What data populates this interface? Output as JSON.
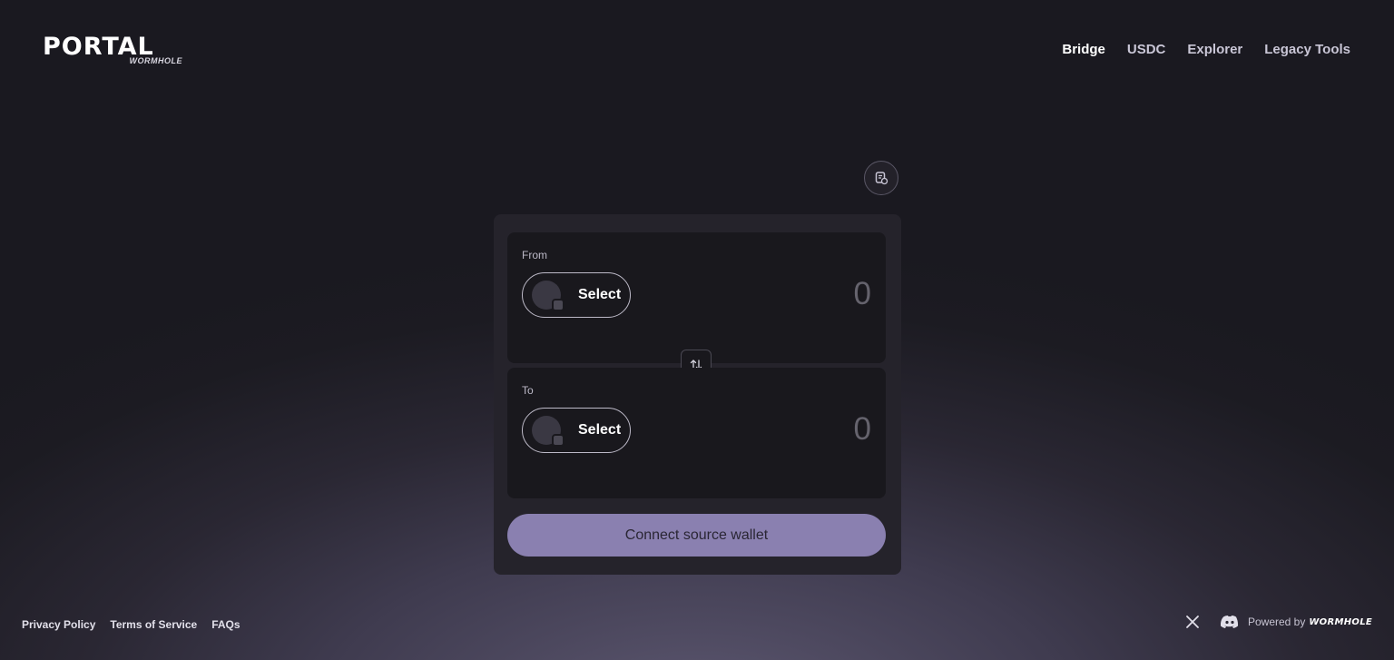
{
  "brand": {
    "name": "PORTAL",
    "sub": "WORMHOLE"
  },
  "nav": [
    {
      "label": "Bridge",
      "active": true
    },
    {
      "label": "USDC",
      "active": false
    },
    {
      "label": "Explorer",
      "active": false
    },
    {
      "label": "Legacy Tools",
      "active": false
    }
  ],
  "settings": {
    "icon": "transaction-history-icon"
  },
  "bridge": {
    "from": {
      "label": "From",
      "select": "Select",
      "amount": "0"
    },
    "to": {
      "label": "To",
      "select": "Select",
      "amount": "0"
    },
    "swap_icon": "swap-arrows-icon",
    "connect_label": "Connect source wallet"
  },
  "footer": {
    "links": [
      "Privacy Policy",
      "Terms of Service",
      "FAQs"
    ],
    "powered_by": "Powered by",
    "powered_brand": "WORMHOLE",
    "social_icons": [
      "x-icon",
      "discord-icon"
    ]
  },
  "colors": {
    "accent_button": "#8a80b0",
    "panel": "#19181d",
    "card": "#25232b"
  }
}
